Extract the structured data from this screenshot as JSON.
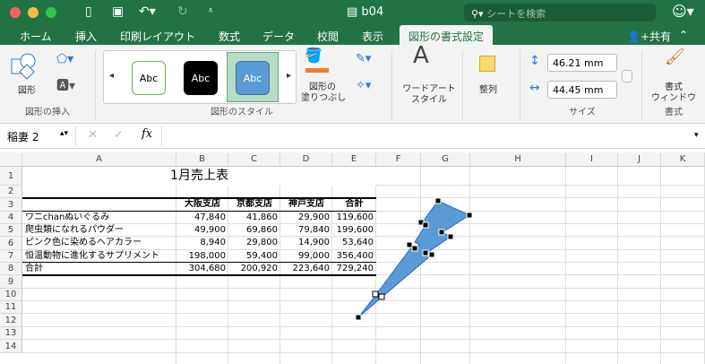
{
  "window": {
    "title": "b04",
    "search_placeholder": "シートを検索"
  },
  "tabs": [
    "ホーム",
    "挿入",
    "印刷レイアウト",
    "数式",
    "データ",
    "校閲",
    "表示",
    "図形の書式設定"
  ],
  "share_label": "共有",
  "ribbon": {
    "insert_group": {
      "shape_label": "図形",
      "group_label": "図形の挿入"
    },
    "style_group": {
      "gallery": [
        "Abc",
        "Abc",
        "Abc"
      ],
      "fill_label": "図形の\n塗りつぶし",
      "group_label": "図形のスタイル"
    },
    "wordart_label": "ワードアート\nスタイル",
    "arrange_label": "整列",
    "size_group": {
      "height": "46.21 mm",
      "width": "44.45 mm",
      "group_label": "サイズ"
    },
    "format_group": {
      "pane_label": "書式\nウィンドウ",
      "group_label": "書式"
    }
  },
  "formula_bar": {
    "name_box": "稲妻 2",
    "fx": "fx",
    "value": ""
  },
  "columns": [
    "A",
    "B",
    "C",
    "D",
    "E",
    "F",
    "G",
    "H",
    "I",
    "J",
    "K"
  ],
  "rows": [
    "1",
    "2",
    "3",
    "4",
    "5",
    "6",
    "7",
    "8",
    "9",
    "10",
    "11",
    "12",
    "13",
    "14"
  ],
  "sheet": {
    "title": "1月売上表",
    "headers": [
      "大阪支店",
      "京都支店",
      "神戸支店",
      "合計"
    ],
    "data": [
      {
        "name": "ワニchanぬいぐるみ",
        "values": [
          "47,840",
          "41,860",
          "29,900",
          "119,600"
        ]
      },
      {
        "name": "爬虫類になれるパウダー",
        "values": [
          "49,900",
          "69,860",
          "79,840",
          "199,600"
        ]
      },
      {
        "name": "ピンク色に染めるヘアカラー",
        "values": [
          "8,940",
          "29,800",
          "14,900",
          "53,640"
        ]
      },
      {
        "name": "恒温動物に進化するサプリメント",
        "values": [
          "198,000",
          "59,400",
          "99,000",
          "356,400"
        ]
      },
      {
        "name": "合計",
        "values": [
          "304,680",
          "200,920",
          "223,640",
          "729,240"
        ]
      }
    ]
  },
  "shape": {
    "type": "lightning-bolt",
    "fill": "#5b9bd5",
    "stroke": "#2f5fd0",
    "selected": true
  },
  "colors": {
    "brand": "#217346"
  }
}
